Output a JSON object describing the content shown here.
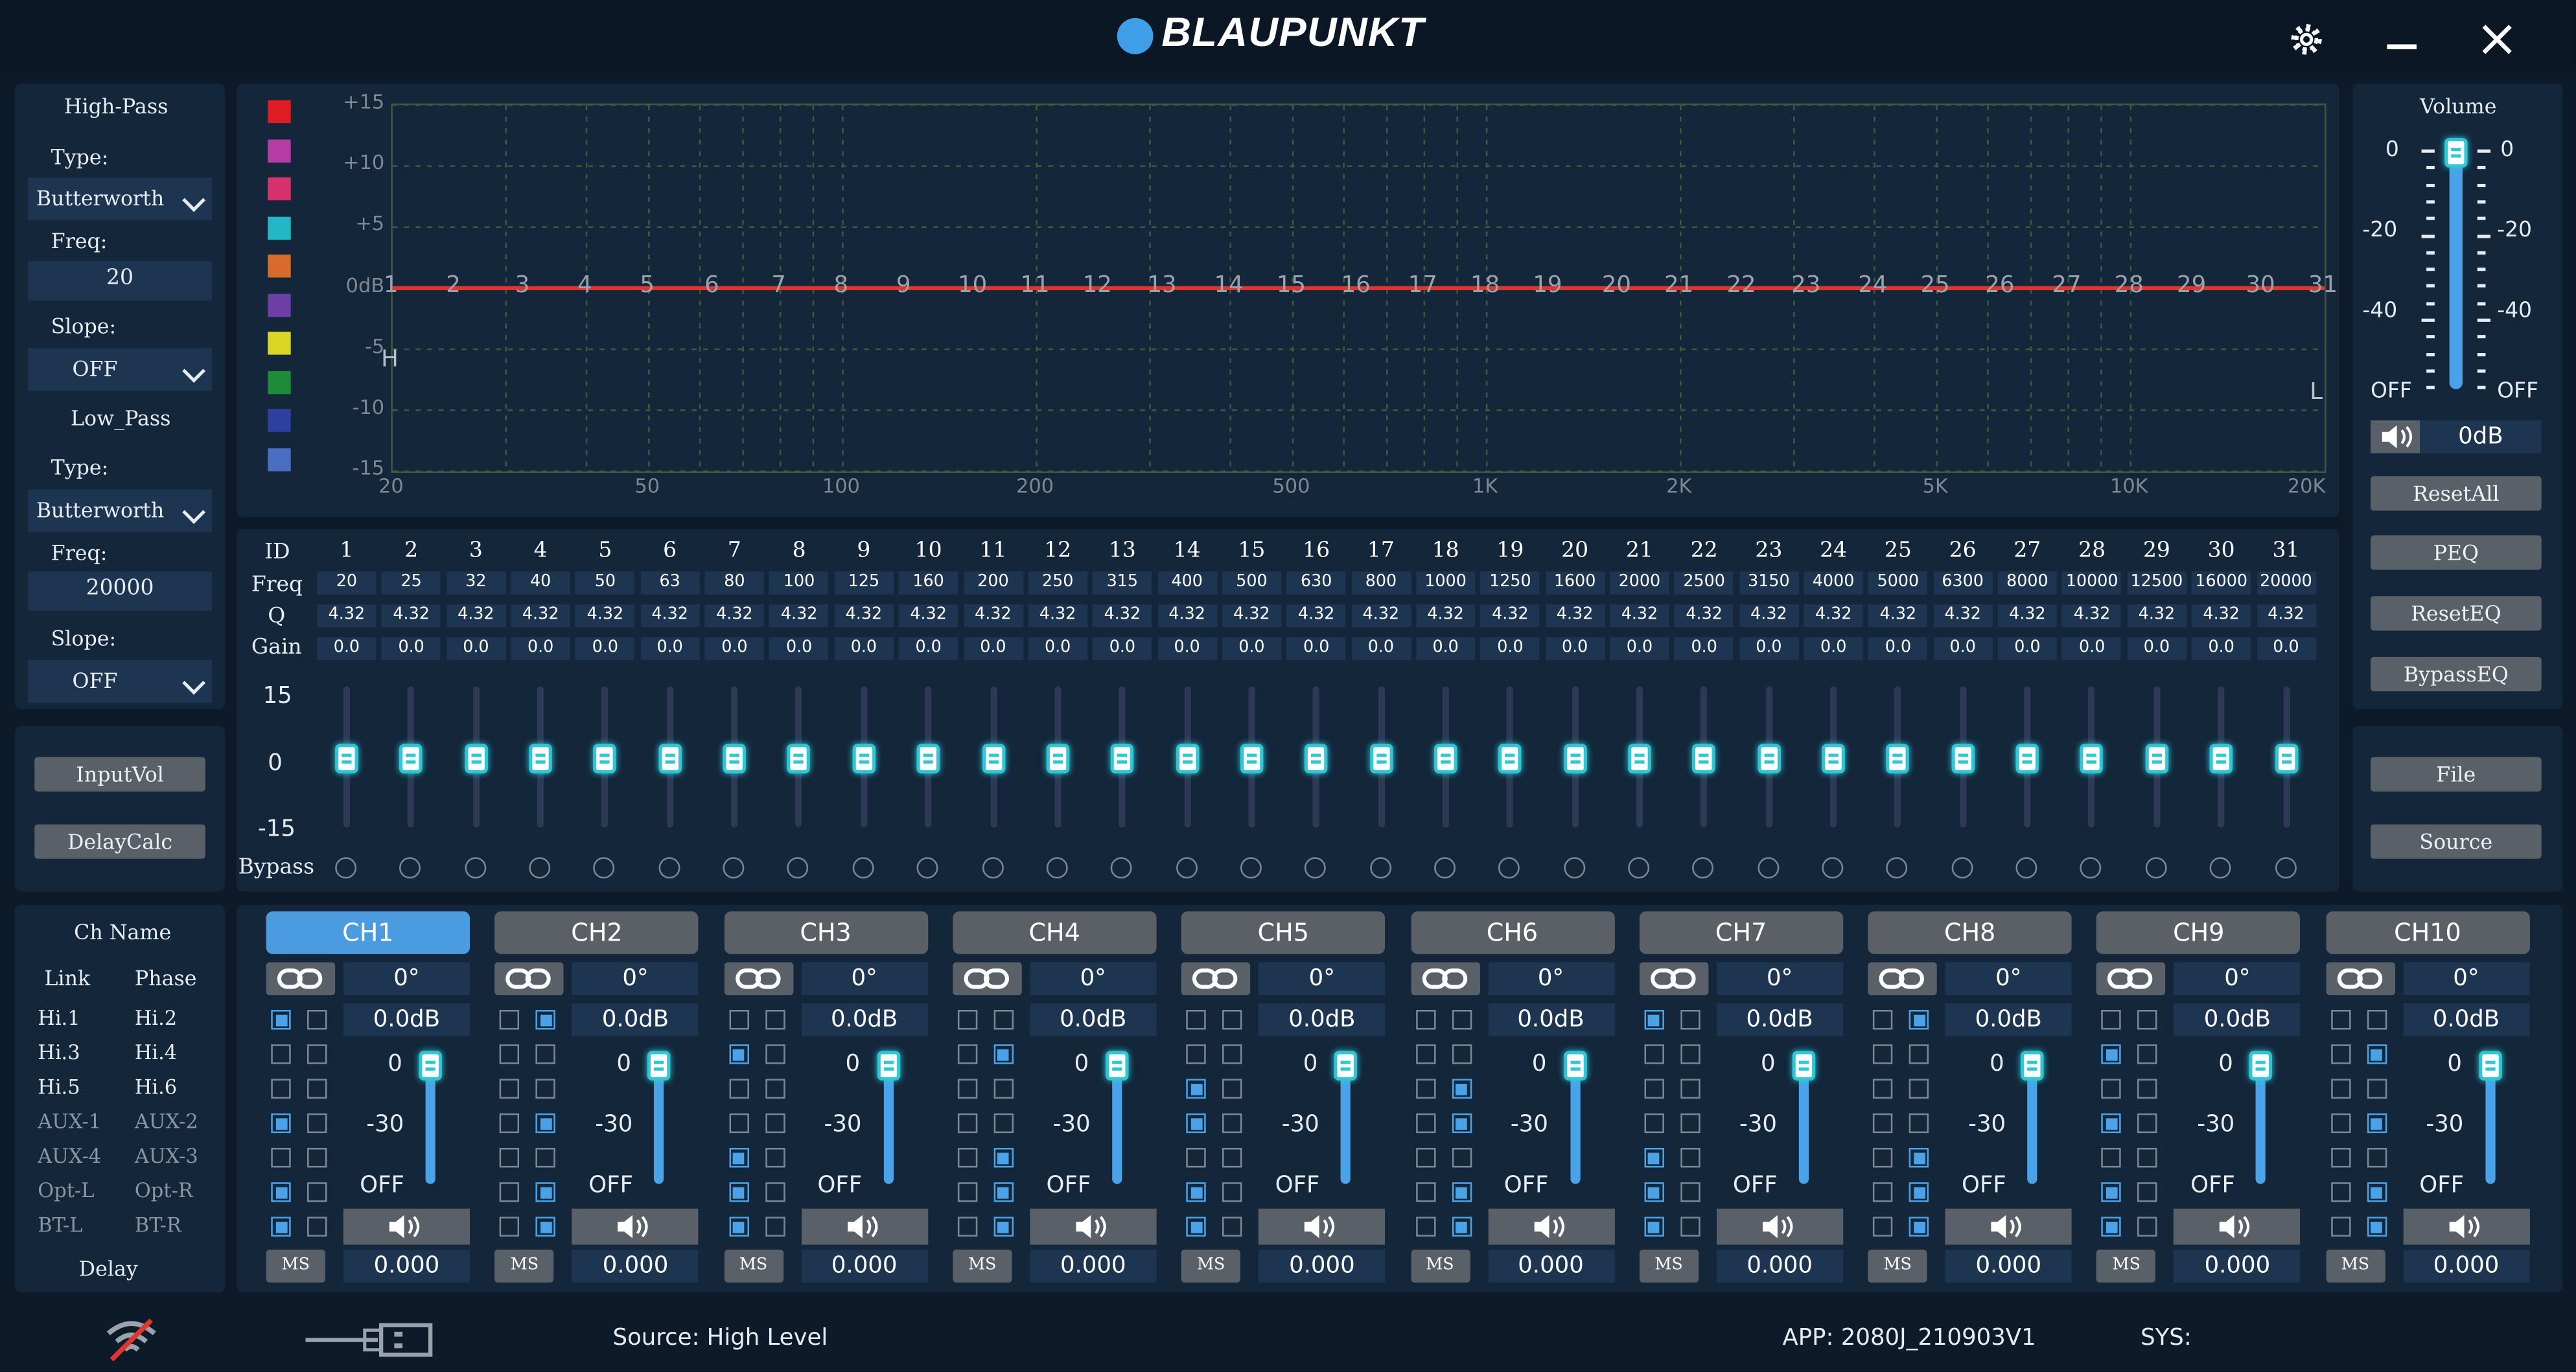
{
  "header": {
    "brand": "BLAUPUNKT"
  },
  "high_pass": {
    "title": "High-Pass",
    "type_label": "Type:",
    "type_value": "Butterworth",
    "freq_label": "Freq:",
    "freq_value": "20",
    "slope_label": "Slope:",
    "slope_value": "OFF"
  },
  "low_pass": {
    "title": "Low_Pass",
    "type_label": "Type:",
    "type_value": "Butterworth",
    "freq_label": "Freq:",
    "freq_value": "20000",
    "slope_label": "Slope:",
    "slope_value": "OFF"
  },
  "left_buttons": {
    "input_vol": "InputVol",
    "delay_calc": "DelayCalc"
  },
  "graph": {
    "y_labels": [
      "+15",
      "+10",
      "+5",
      "0dB",
      "-5",
      "-10",
      "-15"
    ],
    "x_labels": [
      "20",
      "50",
      "100",
      "200",
      "500",
      "1K",
      "2K",
      "5K",
      "10K",
      "20K"
    ],
    "marker_h": "H",
    "marker_l": "L",
    "swatch_colors": [
      "#e01b24",
      "#b83ca6",
      "#d6336c",
      "#22b8c8",
      "#d86a2b",
      "#6b3fa6",
      "#d8d622",
      "#1e8a3a",
      "#2f3fa0",
      "#4a6ec0"
    ]
  },
  "eq": {
    "row_labels": {
      "id": "ID",
      "freq": "Freq",
      "q": "Q",
      "gain": "Gain",
      "bypass": "Bypass"
    },
    "scale": {
      "top": "15",
      "mid": "0",
      "bottom": "-15"
    },
    "ids": [
      "1",
      "2",
      "3",
      "4",
      "5",
      "6",
      "7",
      "8",
      "9",
      "10",
      "11",
      "12",
      "13",
      "14",
      "15",
      "16",
      "17",
      "18",
      "19",
      "20",
      "21",
      "22",
      "23",
      "24",
      "25",
      "26",
      "27",
      "28",
      "29",
      "30",
      "31"
    ],
    "freqs": [
      "20",
      "25",
      "32",
      "40",
      "50",
      "63",
      "80",
      "100",
      "125",
      "160",
      "200",
      "250",
      "315",
      "400",
      "500",
      "630",
      "800",
      "1000",
      "1250",
      "1600",
      "2000",
      "2500",
      "3150",
      "4000",
      "5000",
      "6300",
      "8000",
      "10000",
      "12500",
      "16000",
      "20000"
    ],
    "q": [
      "4.32",
      "4.32",
      "4.32",
      "4.32",
      "4.32",
      "4.32",
      "4.32",
      "4.32",
      "4.32",
      "4.32",
      "4.32",
      "4.32",
      "4.32",
      "4.32",
      "4.32",
      "4.32",
      "4.32",
      "4.32",
      "4.32",
      "4.32",
      "4.32",
      "4.32",
      "4.32",
      "4.32",
      "4.32",
      "4.32",
      "4.32",
      "4.32",
      "4.32",
      "4.32",
      "4.32"
    ],
    "gain": [
      "0.0",
      "0.0",
      "0.0",
      "0.0",
      "0.0",
      "0.0",
      "0.0",
      "0.0",
      "0.0",
      "0.0",
      "0.0",
      "0.0",
      "0.0",
      "0.0",
      "0.0",
      "0.0",
      "0.0",
      "0.0",
      "0.0",
      "0.0",
      "0.0",
      "0.0",
      "0.0",
      "0.0",
      "0.0",
      "0.0",
      "0.0",
      "0.0",
      "0.0",
      "0.0",
      "0.0"
    ]
  },
  "volume": {
    "title": "Volume",
    "left_scale": [
      "0",
      "-20",
      "-40",
      "OFF"
    ],
    "right_scale": [
      "0",
      "-20",
      "-40",
      "OFF"
    ],
    "value": "0dB",
    "level_fraction": 1.0
  },
  "right_buttons": {
    "reset_all": "ResetAll",
    "peq": "PEQ",
    "reset_eq": "ResetEQ",
    "bypass_eq": "BypassEQ",
    "file": "File",
    "source": "Source"
  },
  "channel_labels": {
    "ch_name": "Ch Name",
    "link": "Link",
    "phase": "Phase",
    "inputs": [
      [
        "Hi.1",
        "Hi.2"
      ],
      [
        "Hi.3",
        "Hi.4"
      ],
      [
        "Hi.5",
        "Hi.6"
      ],
      [
        "AUX-1",
        "AUX-2"
      ],
      [
        "AUX-4",
        "AUX-3"
      ],
      [
        "Opt-L",
        "Opt-R"
      ],
      [
        "BT-L",
        "BT-R"
      ]
    ],
    "delay": "Delay"
  },
  "channels": [
    {
      "name": "CH1",
      "phase": "0°",
      "gain": "0.0dB",
      "scale_top": "0",
      "scale_mid": "-30",
      "scale_off": "OFF",
      "ms": "MS",
      "delay": "0.000",
      "active": true
    },
    {
      "name": "CH2",
      "phase": "0°",
      "gain": "0.0dB",
      "scale_top": "0",
      "scale_mid": "-30",
      "scale_off": "OFF",
      "ms": "MS",
      "delay": "0.000"
    },
    {
      "name": "CH3",
      "phase": "0°",
      "gain": "0.0dB",
      "scale_top": "0",
      "scale_mid": "-30",
      "scale_off": "OFF",
      "ms": "MS",
      "delay": "0.000"
    },
    {
      "name": "CH4",
      "phase": "0°",
      "gain": "0.0dB",
      "scale_top": "0",
      "scale_mid": "-30",
      "scale_off": "OFF",
      "ms": "MS",
      "delay": "0.000"
    },
    {
      "name": "CH5",
      "phase": "0°",
      "gain": "0.0dB",
      "scale_top": "0",
      "scale_mid": "-30",
      "scale_off": "OFF",
      "ms": "MS",
      "delay": "0.000"
    },
    {
      "name": "CH6",
      "phase": "0°",
      "gain": "0.0dB",
      "scale_top": "0",
      "scale_mid": "-30",
      "scale_off": "OFF",
      "ms": "MS",
      "delay": "0.000"
    },
    {
      "name": "CH7",
      "phase": "0°",
      "gain": "0.0dB",
      "scale_top": "0",
      "scale_mid": "-30",
      "scale_off": "OFF",
      "ms": "MS",
      "delay": "0.000"
    },
    {
      "name": "CH8",
      "phase": "0°",
      "gain": "0.0dB",
      "scale_top": "0",
      "scale_mid": "-30",
      "scale_off": "OFF",
      "ms": "MS",
      "delay": "0.000"
    },
    {
      "name": "CH9",
      "phase": "0°",
      "gain": "0.0dB",
      "scale_top": "0",
      "scale_mid": "-30",
      "scale_off": "OFF",
      "ms": "MS",
      "delay": "0.000"
    },
    {
      "name": "CH10",
      "phase": "0°",
      "gain": "0.0dB",
      "scale_top": "0",
      "scale_mid": "-30",
      "scale_off": "OFF",
      "ms": "MS",
      "delay": "0.000"
    }
  ],
  "status_bar": {
    "source": "Source: High Level",
    "app": "APP: 2080J_210903V1",
    "sys": "SYS:"
  }
}
